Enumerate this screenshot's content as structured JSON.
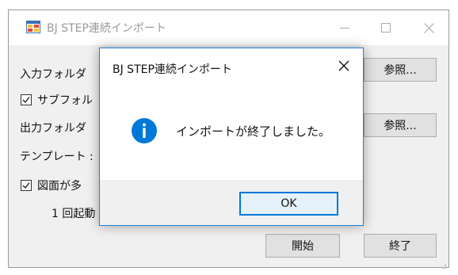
{
  "main_window": {
    "title": "BJ STEP連続インポート",
    "labels": {
      "input_folder": "入力フォルダ",
      "subfolder": "サブフォル",
      "output_folder": "出力フォルダ",
      "template": "テンプレート :",
      "drawing_multi": "図面が多",
      "one_run": "1 回起動"
    },
    "subfolder_checked": true,
    "drawing_multi_checked": true,
    "browse_label": "参照...",
    "start_label": "開始",
    "exit_label": "終了"
  },
  "dialog": {
    "title": "BJ STEP連続インポート",
    "message": "インポートが終了しました。",
    "ok_label": "OK",
    "icon": "info-icon",
    "accent_color": "#0078d7"
  }
}
